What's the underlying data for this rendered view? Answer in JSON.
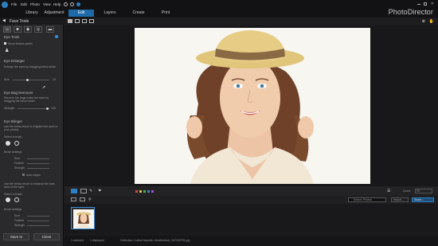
{
  "menu": {
    "items": [
      "File",
      "Edit",
      "Photo",
      "View",
      "Help"
    ]
  },
  "brand": "PhotoDirector",
  "main_tabs": [
    {
      "label": "Library"
    },
    {
      "label": "Adjustment"
    },
    {
      "label": "Edit"
    },
    {
      "label": "Layers"
    },
    {
      "label": "Create"
    },
    {
      "label": "Print"
    }
  ],
  "panel": {
    "title": "Face Tools",
    "section_eye_tools": "Eye Tools",
    "show_feature_points": "Show feature points",
    "eye_enlarger": {
      "title": "Eye Enlarger",
      "desc": "Enlarge the eyes by dragging below slider.",
      "size_label": "Size",
      "size_value": "24"
    },
    "eye_bag_remover": {
      "title": "Eye Bag Remover",
      "desc": "Remove the bags under the eyes by dragging the below slider.",
      "strength_label": "Strength",
      "strength_value": "100"
    },
    "eye_blinger": {
      "title": "Eye Blinger",
      "desc": "Use the below brush to brighten the eyes in your photos.",
      "select_brush": "Select a brush:",
      "brush_settings": "Brush settings",
      "size": "Size",
      "feather": "Feather",
      "strength": "Strength",
      "auto_edges": "Auto edges"
    },
    "eye_blinger2": {
      "desc": "Use the below brush to enhance the dark area of the eyes.",
      "select_brush": "Select a brush:",
      "brush_settings": "Brush settings",
      "size": "Size",
      "feather": "Feather",
      "strength": "Strength"
    },
    "save_to": "Save to",
    "close": "Close"
  },
  "filmstrip": {
    "search_placeholder": "Search Photos",
    "zoom_label": "Zoom:",
    "zoom_value": "Fit",
    "import_label": "Import...",
    "share_label": "Share..."
  },
  "status": {
    "selected": "1 selected",
    "displayed": "1 displayed",
    "path": "Collection / Latest Imports / shutterstock_187315751.jpg"
  },
  "colors": {
    "accent": "#1e6aa8",
    "panel_bg": "#2a2a2d",
    "dark_bg": "#1b1b1d"
  }
}
